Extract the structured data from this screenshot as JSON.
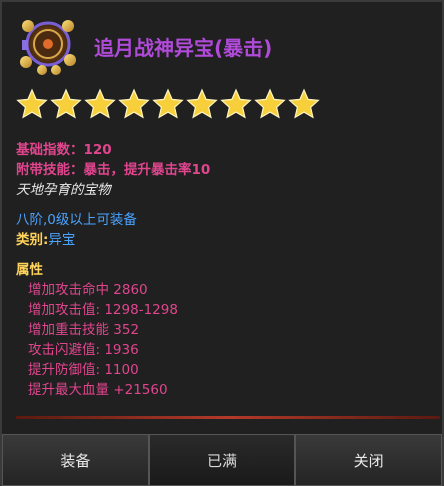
{
  "item": {
    "title": "追月战神异宝(暴击)",
    "stars": 9,
    "base": "基础指数：120",
    "skill": "附带技能：暴击，提升暴击率10",
    "lore": "天地孕育的宝物",
    "requirement": "八阶,0级以上可装备",
    "category_prefix": "类别:",
    "category_value": "异宝",
    "attr_title": "属性",
    "attributes": [
      "增加攻击命中 2860",
      "增加攻击值:  1298-1298",
      "增加重击技能 352",
      "攻击闪避值: 1936",
      "提升防御值: 1100",
      "提升最大血量 +21560"
    ]
  },
  "buttons": {
    "equip": "装备",
    "full": "已满",
    "close": "关闭"
  },
  "colors": {
    "title": "#b04ad8",
    "pink": "#e0458e",
    "blue": "#4aa3ff",
    "gold": "#ffd35a"
  },
  "icons": {
    "item": "treasure-bag-icon",
    "star": "gold-star-icon"
  }
}
